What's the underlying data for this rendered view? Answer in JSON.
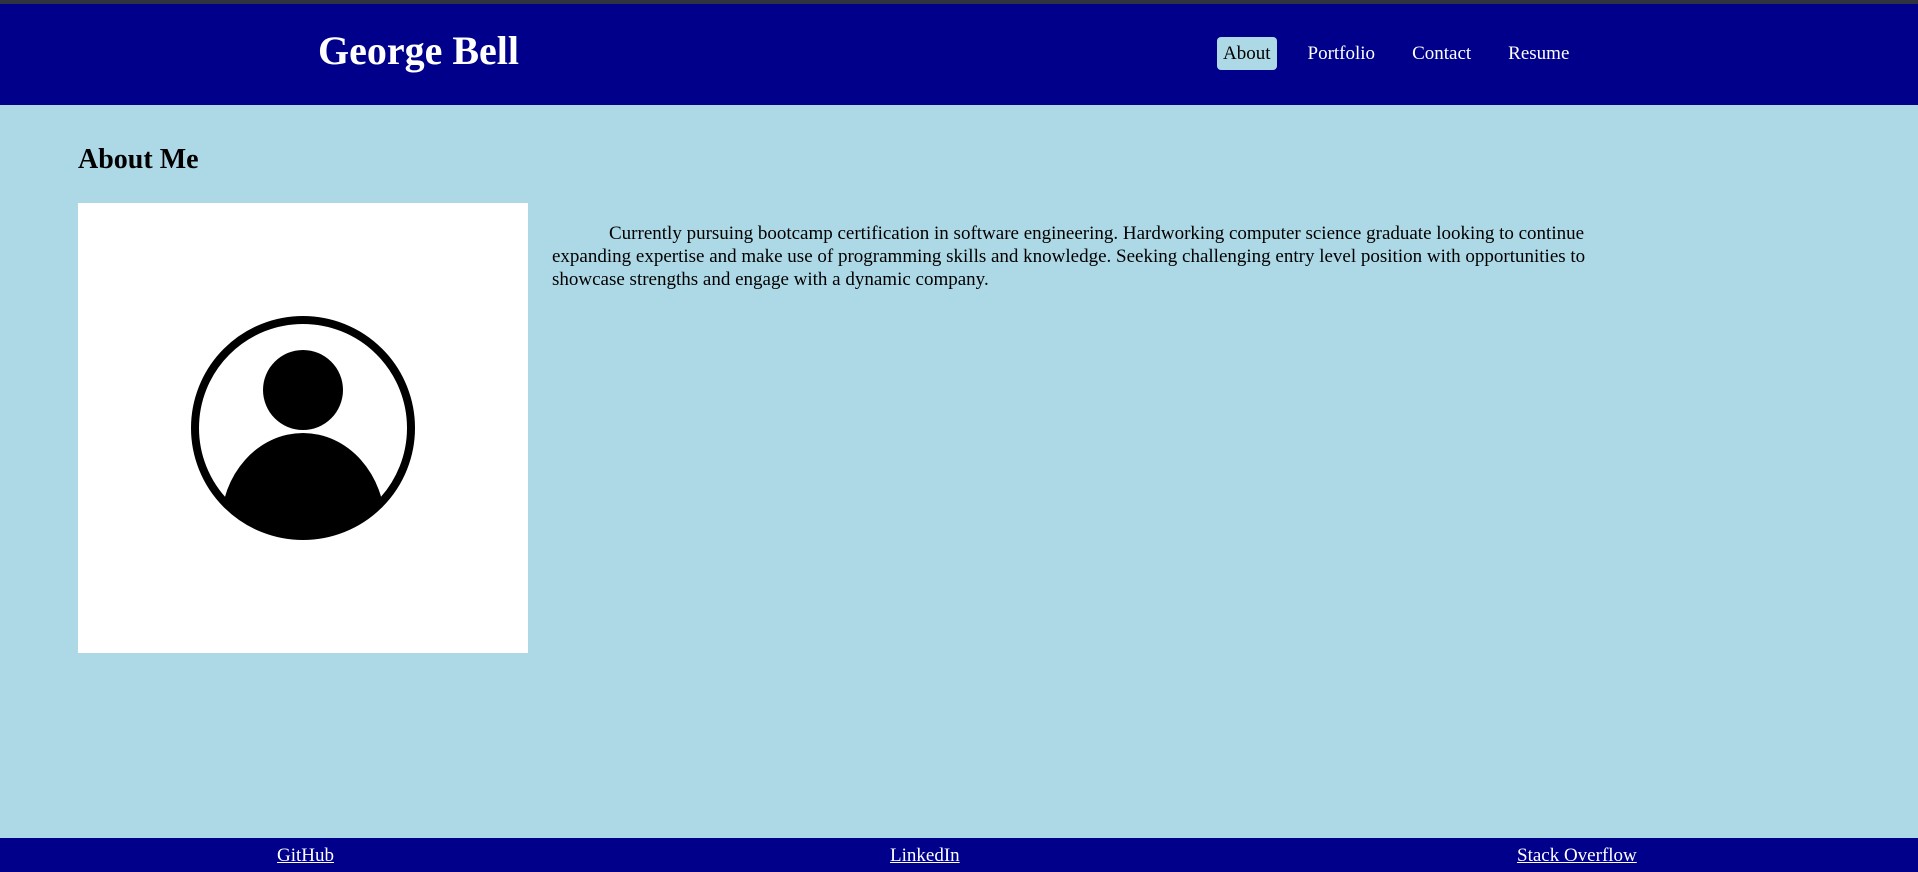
{
  "header": {
    "title": "George Bell",
    "nav": [
      {
        "label": "About",
        "active": true
      },
      {
        "label": "Portfolio",
        "active": false
      },
      {
        "label": "Contact",
        "active": false
      },
      {
        "label": "Resume",
        "active": false
      }
    ]
  },
  "main": {
    "heading": "About Me",
    "avatar_icon": "user-circle-icon",
    "bio": "Currently pursuing bootcamp certification in software engineering. Hardworking computer science graduate looking to continue expanding expertise and make use of programming skills and knowledge. Seeking challenging entry level position with opportunities to showcase strengths and engage with a dynamic company."
  },
  "footer": {
    "links": [
      {
        "label": "GitHub"
      },
      {
        "label": "LinkedIn"
      },
      {
        "label": "Stack Overflow"
      }
    ]
  },
  "colors": {
    "page_background": "#add8e6",
    "header_background": "#00008b",
    "footer_background": "#00008b",
    "active_nav_background": "#add8e6",
    "text_light": "#ffffff",
    "text_dark": "#000000"
  }
}
